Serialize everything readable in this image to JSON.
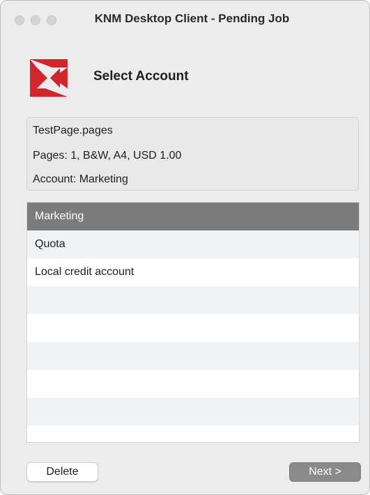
{
  "window": {
    "title": "KNM Desktop Client - Pending Job"
  },
  "header": {
    "logo_icon": "kyocera-logo-icon",
    "heading": "Select Account",
    "brand_color": "#d2262e"
  },
  "job_info": {
    "file_name": "TestPage.pages",
    "details": "Pages: 1, B&W, A4, USD 1.00",
    "account": "Account: Marketing"
  },
  "accounts": {
    "items": [
      {
        "label": "Marketing",
        "selected": true
      },
      {
        "label": "Quota",
        "selected": false
      },
      {
        "label": "Local credit account",
        "selected": false
      }
    ],
    "selection_color": "#7b7b7b",
    "stripe_color": "#f0f2f3"
  },
  "footer": {
    "delete_label": "Delete",
    "next_label": "Next >"
  }
}
